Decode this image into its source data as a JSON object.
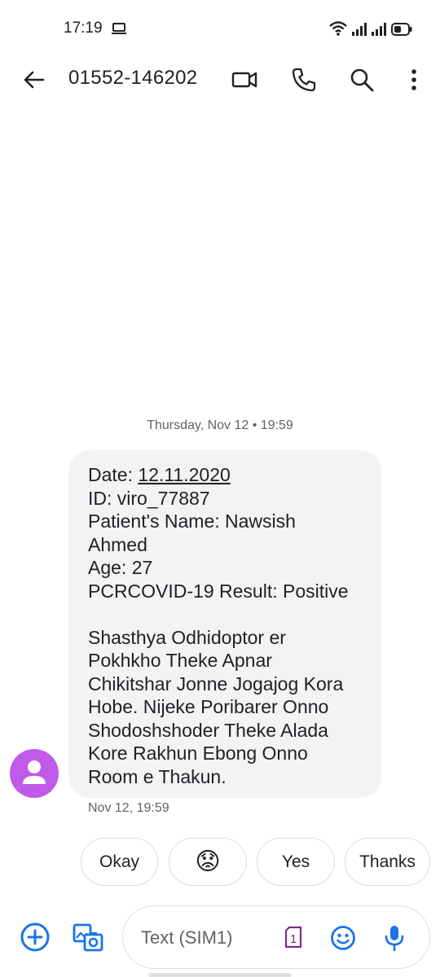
{
  "status_bar": {
    "time": "17:19",
    "icons": [
      "laptop-icon",
      "wifi-icon",
      "signal-icon",
      "signal-icon",
      "battery-icon"
    ]
  },
  "app_bar": {
    "contact": "01552-146202",
    "icons": [
      "back-arrow-icon",
      "video-call-icon",
      "phone-call-icon",
      "search-icon",
      "more-vert-icon"
    ]
  },
  "conversation": {
    "date_header": "Thursday, Nov 12 • 19:59",
    "message": {
      "date_label": "Date: ",
      "date_value": "12.11.2020",
      "lines": [
        "ID: viro_77887",
        "Patient's Name: Nawsish",
        "Ahmed",
        "Age: 27",
        "PCRCOVID-19 Result: Positive",
        "",
        "Shasthya Odhidoptor er",
        "Pokhkho Theke Apnar",
        "Chikitshar Jonne Jogajog Kora",
        "Hobe. Nijeke Poribarer Onno",
        "Shodoshshoder Theke Alada",
        "Kore Rakhun Ebong Onno",
        "Room e Thakun."
      ],
      "timestamp": "Nov 12, 19:59"
    }
  },
  "smart_replies": {
    "okay": "Okay",
    "emoji": "😟",
    "yes": "Yes",
    "thanks": "Thanks"
  },
  "compose": {
    "placeholder": "Text (SIM1)",
    "sim_label": "1",
    "icons": [
      "add-circle-icon",
      "gallery-icon",
      "sim-icon",
      "emoji-icon",
      "mic-icon"
    ]
  },
  "colors": {
    "accent": "#1a73e8",
    "avatar": "#c05ae8",
    "bubble": "#f1f3f4",
    "sim": "#7b2c8a",
    "text": "#202124",
    "secondary_text": "#5f6368"
  }
}
